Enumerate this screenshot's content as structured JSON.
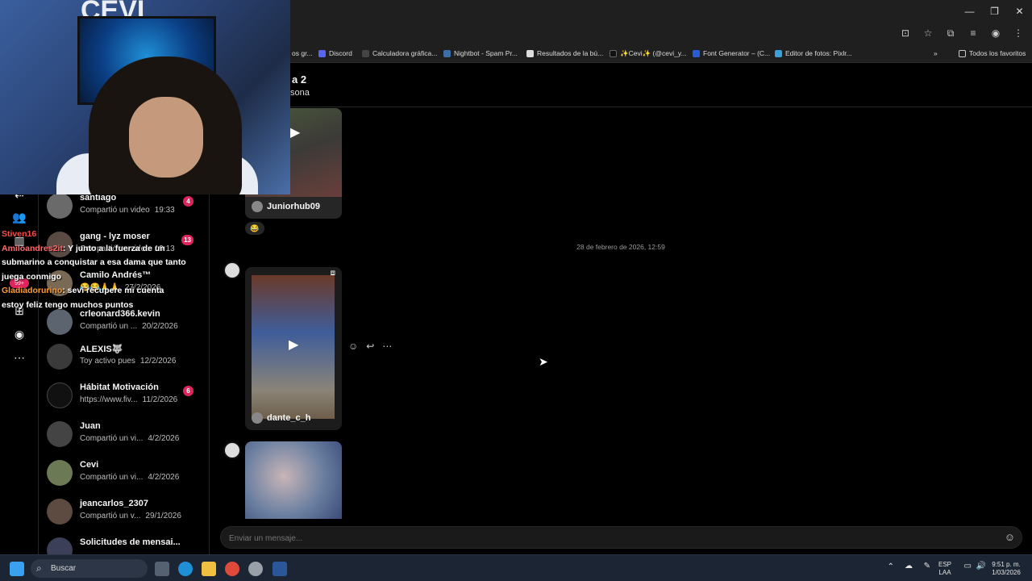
{
  "bookmarks": [
    {
      "label": "os gr...",
      "color": "#888888"
    },
    {
      "label": "Discord",
      "color": "#5865f2"
    },
    {
      "label": "Calculadora gráfica...",
      "color": "#444444"
    },
    {
      "label": "Nightbot - Spam Pr...",
      "color": "#3c6ea8"
    },
    {
      "label": "Resultados de la bú...",
      "color": "#dddddd"
    },
    {
      "label": "✨Cevi✨ (@cevi_y...",
      "color": "#111111"
    },
    {
      "label": "Font Generator – (C...",
      "color": "#2a5bd7"
    },
    {
      "label": "Editor de fotos: Pixlr...",
      "color": "#3aa0d8"
    },
    {
      "label": "Todos los favoritos",
      "color": "#cccccc"
    }
  ],
  "chat": {
    "title": "a 2",
    "subtitle": "sona",
    "date_separator": "28 de febrero de 2026, 12:59",
    "cards": [
      {
        "user": "Juniorhub09"
      },
      {
        "user": "dante_c_h"
      }
    ],
    "composer_placeholder": "Enviar un mensaje..."
  },
  "conversations": [
    {
      "name": "santiago",
      "preview": "Compartió un video",
      "time": "19:33",
      "badge": "4"
    },
    {
      "name": "gang - lyz moser",
      "preview": "Compartió un video",
      "time": "19:13",
      "badge": "13"
    },
    {
      "name": "Camilo Andrés™",
      "preview": "😂😂🙏🙏",
      "time": "27/2/2026",
      "badge": ""
    },
    {
      "name": "crleonard366.kevin",
      "preview": "Compartió un ...",
      "time": "20/2/2026",
      "badge": ""
    },
    {
      "name": "ALEXIS🐺",
      "preview": "Toy activo pues",
      "time": "12/2/2026",
      "badge": ""
    },
    {
      "name": "Hábitat Motivación",
      "preview": "https://www.fiv...",
      "time": "11/2/2026",
      "badge": "6"
    },
    {
      "name": "Juan",
      "preview": "Compartió un vi...",
      "time": "4/2/2026",
      "badge": ""
    },
    {
      "name": "Cevi",
      "preview": "Compartió un vi...",
      "time": "4/2/2026",
      "badge": ""
    },
    {
      "name": "jeancarlos_2307",
      "preview": "Compartió un v...",
      "time": "29/1/2026",
      "badge": ""
    },
    {
      "name": "Solicitudes de mensai...",
      "preview": "",
      "time": "",
      "badge": ""
    }
  ],
  "nav_badge": "99+",
  "overlay_chat": [
    {
      "user": "Stiven16",
      "text": ""
    },
    {
      "user": "Amiloandres2it",
      "text": ": Y junto a la fuerza de un submarino a conquistar a esa dama que tanto juega conmigo"
    },
    {
      "user": "Gladiadorurino",
      "text": ": sevi recupere mi cuenta estoy feliz tengo muchos puntos"
    }
  ],
  "webcam_logo": "CEVI",
  "taskbar": {
    "search_label": "Buscar",
    "lang_top": "ESP",
    "lang_bottom": "LAA",
    "time": "9:51 p. m.",
    "date": "1/03/2026"
  }
}
